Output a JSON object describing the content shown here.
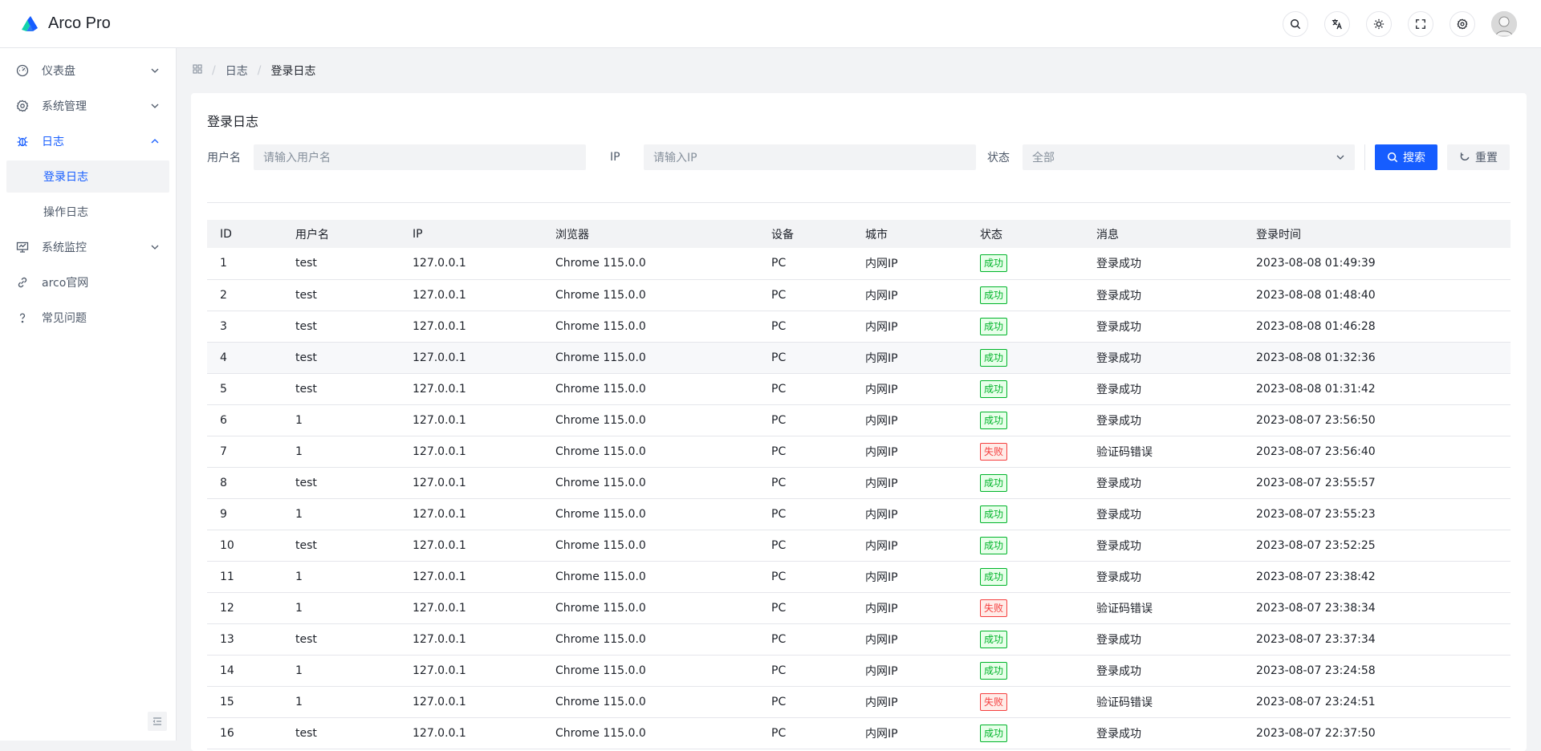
{
  "header": {
    "app_name": "Arco Pro",
    "actions": [
      "search-icon",
      "language-icon",
      "theme-icon",
      "fullscreen-icon",
      "settings-icon"
    ]
  },
  "sidebar": {
    "items": [
      {
        "label": "仪表盘",
        "icon": "dashboard-icon"
      },
      {
        "label": "系统管理",
        "icon": "settings-icon"
      },
      {
        "label": "日志",
        "icon": "bug-icon",
        "open": true
      },
      {
        "label": "系统监控",
        "icon": "monitor-icon"
      },
      {
        "label": "arco官网",
        "icon": "link-icon"
      },
      {
        "label": "常见问题",
        "icon": "question-icon"
      }
    ],
    "log_children": [
      "登录日志",
      "操作日志"
    ]
  },
  "breadcrumb": [
    "日志",
    "登录日志"
  ],
  "page": {
    "title": "登录日志",
    "filters": {
      "username_label": "用户名",
      "username_placeholder": "请输入用户名",
      "ip_label": "IP",
      "ip_placeholder": "请输入IP",
      "status_label": "状态",
      "status_value": "全部",
      "search_label": "搜索",
      "reset_label": "重置"
    }
  },
  "table": {
    "columns": [
      "ID",
      "用户名",
      "IP",
      "浏览器",
      "设备",
      "城市",
      "状态",
      "消息",
      "登录时间"
    ],
    "rows": [
      [
        "1",
        "test",
        "127.0.0.1",
        "Chrome 115.0.0",
        "PC",
        "内网IP",
        "成功",
        "登录成功",
        "2023-08-08 01:49:39"
      ],
      [
        "2",
        "test",
        "127.0.0.1",
        "Chrome 115.0.0",
        "PC",
        "内网IP",
        "成功",
        "登录成功",
        "2023-08-08 01:48:40"
      ],
      [
        "3",
        "test",
        "127.0.0.1",
        "Chrome 115.0.0",
        "PC",
        "内网IP",
        "成功",
        "登录成功",
        "2023-08-08 01:46:28"
      ],
      [
        "4",
        "test",
        "127.0.0.1",
        "Chrome 115.0.0",
        "PC",
        "内网IP",
        "成功",
        "登录成功",
        "2023-08-08 01:32:36"
      ],
      [
        "5",
        "test",
        "127.0.0.1",
        "Chrome 115.0.0",
        "PC",
        "内网IP",
        "成功",
        "登录成功",
        "2023-08-08 01:31:42"
      ],
      [
        "6",
        "1",
        "127.0.0.1",
        "Chrome 115.0.0",
        "PC",
        "内网IP",
        "成功",
        "登录成功",
        "2023-08-07 23:56:50"
      ],
      [
        "7",
        "1",
        "127.0.0.1",
        "Chrome 115.0.0",
        "PC",
        "内网IP",
        "失败",
        "验证码错误",
        "2023-08-07 23:56:40"
      ],
      [
        "8",
        "test",
        "127.0.0.1",
        "Chrome 115.0.0",
        "PC",
        "内网IP",
        "成功",
        "登录成功",
        "2023-08-07 23:55:57"
      ],
      [
        "9",
        "1",
        "127.0.0.1",
        "Chrome 115.0.0",
        "PC",
        "内网IP",
        "成功",
        "登录成功",
        "2023-08-07 23:55:23"
      ],
      [
        "10",
        "test",
        "127.0.0.1",
        "Chrome 115.0.0",
        "PC",
        "内网IP",
        "成功",
        "登录成功",
        "2023-08-07 23:52:25"
      ],
      [
        "11",
        "1",
        "127.0.0.1",
        "Chrome 115.0.0",
        "PC",
        "内网IP",
        "成功",
        "登录成功",
        "2023-08-07 23:38:42"
      ],
      [
        "12",
        "1",
        "127.0.0.1",
        "Chrome 115.0.0",
        "PC",
        "内网IP",
        "失败",
        "验证码错误",
        "2023-08-07 23:38:34"
      ],
      [
        "13",
        "test",
        "127.0.0.1",
        "Chrome 115.0.0",
        "PC",
        "内网IP",
        "成功",
        "登录成功",
        "2023-08-07 23:37:34"
      ],
      [
        "14",
        "1",
        "127.0.0.1",
        "Chrome 115.0.0",
        "PC",
        "内网IP",
        "成功",
        "登录成功",
        "2023-08-07 23:24:58"
      ],
      [
        "15",
        "1",
        "127.0.0.1",
        "Chrome 115.0.0",
        "PC",
        "内网IP",
        "失败",
        "验证码错误",
        "2023-08-07 23:24:51"
      ],
      [
        "16",
        "test",
        "127.0.0.1",
        "Chrome 115.0.0",
        "PC",
        "内网IP",
        "成功",
        "登录成功",
        "2023-08-07 22:37:50"
      ]
    ]
  },
  "colors": {
    "primary": "#165dff",
    "success": "#00b42a",
    "danger": "#f53f3f"
  }
}
